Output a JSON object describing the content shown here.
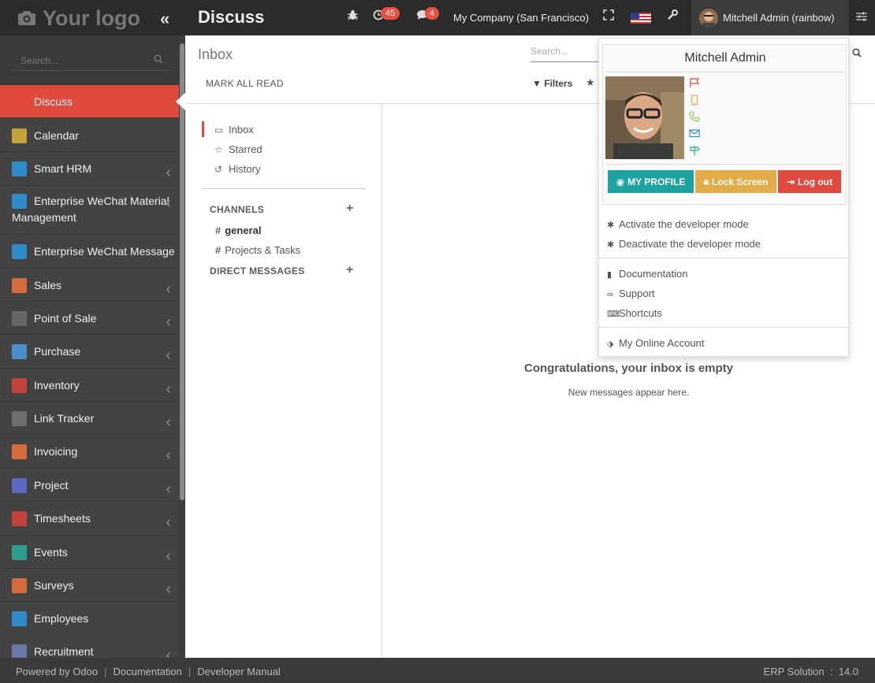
{
  "topbar": {
    "logo_text": "Your logo",
    "app_title": "Discuss",
    "activity_count": "45",
    "messages_count": "4",
    "company": "My Company (San Francisco)",
    "user": "Mitchell Admin (rainbow)"
  },
  "sidebar": {
    "search_placeholder": "Search...",
    "items": [
      {
        "label": "Discuss",
        "color": "#e0493d"
      },
      {
        "label": "Calendar",
        "color": "#c3a23b"
      },
      {
        "label": "Smart HRM",
        "color": "#2f8bc9"
      },
      {
        "label": "Enterprise WeChat Material Management",
        "color": "#2f8bc9"
      },
      {
        "label": "Enterprise WeChat Message",
        "color": "#2f8bc9"
      },
      {
        "label": "Sales",
        "color": "#d36d3e"
      },
      {
        "label": "Point of Sale",
        "color": "#666666"
      },
      {
        "label": "Purchase",
        "color": "#4a8fc9"
      },
      {
        "label": "Inventory",
        "color": "#c0433e"
      },
      {
        "label": "Link Tracker",
        "color": "#6f6f6f"
      },
      {
        "label": "Invoicing",
        "color": "#d36d3e"
      },
      {
        "label": "Project",
        "color": "#5c6bc0"
      },
      {
        "label": "Timesheets",
        "color": "#c0433e"
      },
      {
        "label": "Events",
        "color": "#2a9d8f"
      },
      {
        "label": "Surveys",
        "color": "#d36d3e"
      },
      {
        "label": "Employees",
        "color": "#2f8bc9"
      },
      {
        "label": "Recruitment",
        "color": "#6a7aa8"
      }
    ]
  },
  "control_panel": {
    "title": "Inbox",
    "search_placeholder": "Search...",
    "mark_all_read": "MARK ALL READ",
    "filters": "Filters"
  },
  "discuss": {
    "mailboxes": [
      "Inbox",
      "Starred",
      "History"
    ],
    "channels_header": "CHANNELS",
    "channels": [
      "general",
      "Projects & Tasks"
    ],
    "direct_messages_header": "DIRECT MESSAGES",
    "empty_title": "Congratulations, your inbox is empty",
    "empty_subtitle": "New messages appear here."
  },
  "user_menu": {
    "name": "Mitchell Admin",
    "my_profile": "MY PROFILE",
    "lock_screen": "Lock Screen",
    "log_out": "Log out",
    "activate_dev": "Activate the developer mode",
    "deactivate_dev": "Deactivate the developer mode",
    "documentation": "Documentation",
    "support": "Support",
    "shortcuts": "Shortcuts",
    "online_account": "My Online Account",
    "colors": {
      "profile": "#1fa3a0",
      "lock": "#e2ac49",
      "logout": "#e0493d"
    }
  },
  "footer": {
    "powered": "Powered by Odoo",
    "documentation": "Documentation",
    "developer_manual": "Developer Manual",
    "version": "ERP Solution  :  14.0"
  }
}
